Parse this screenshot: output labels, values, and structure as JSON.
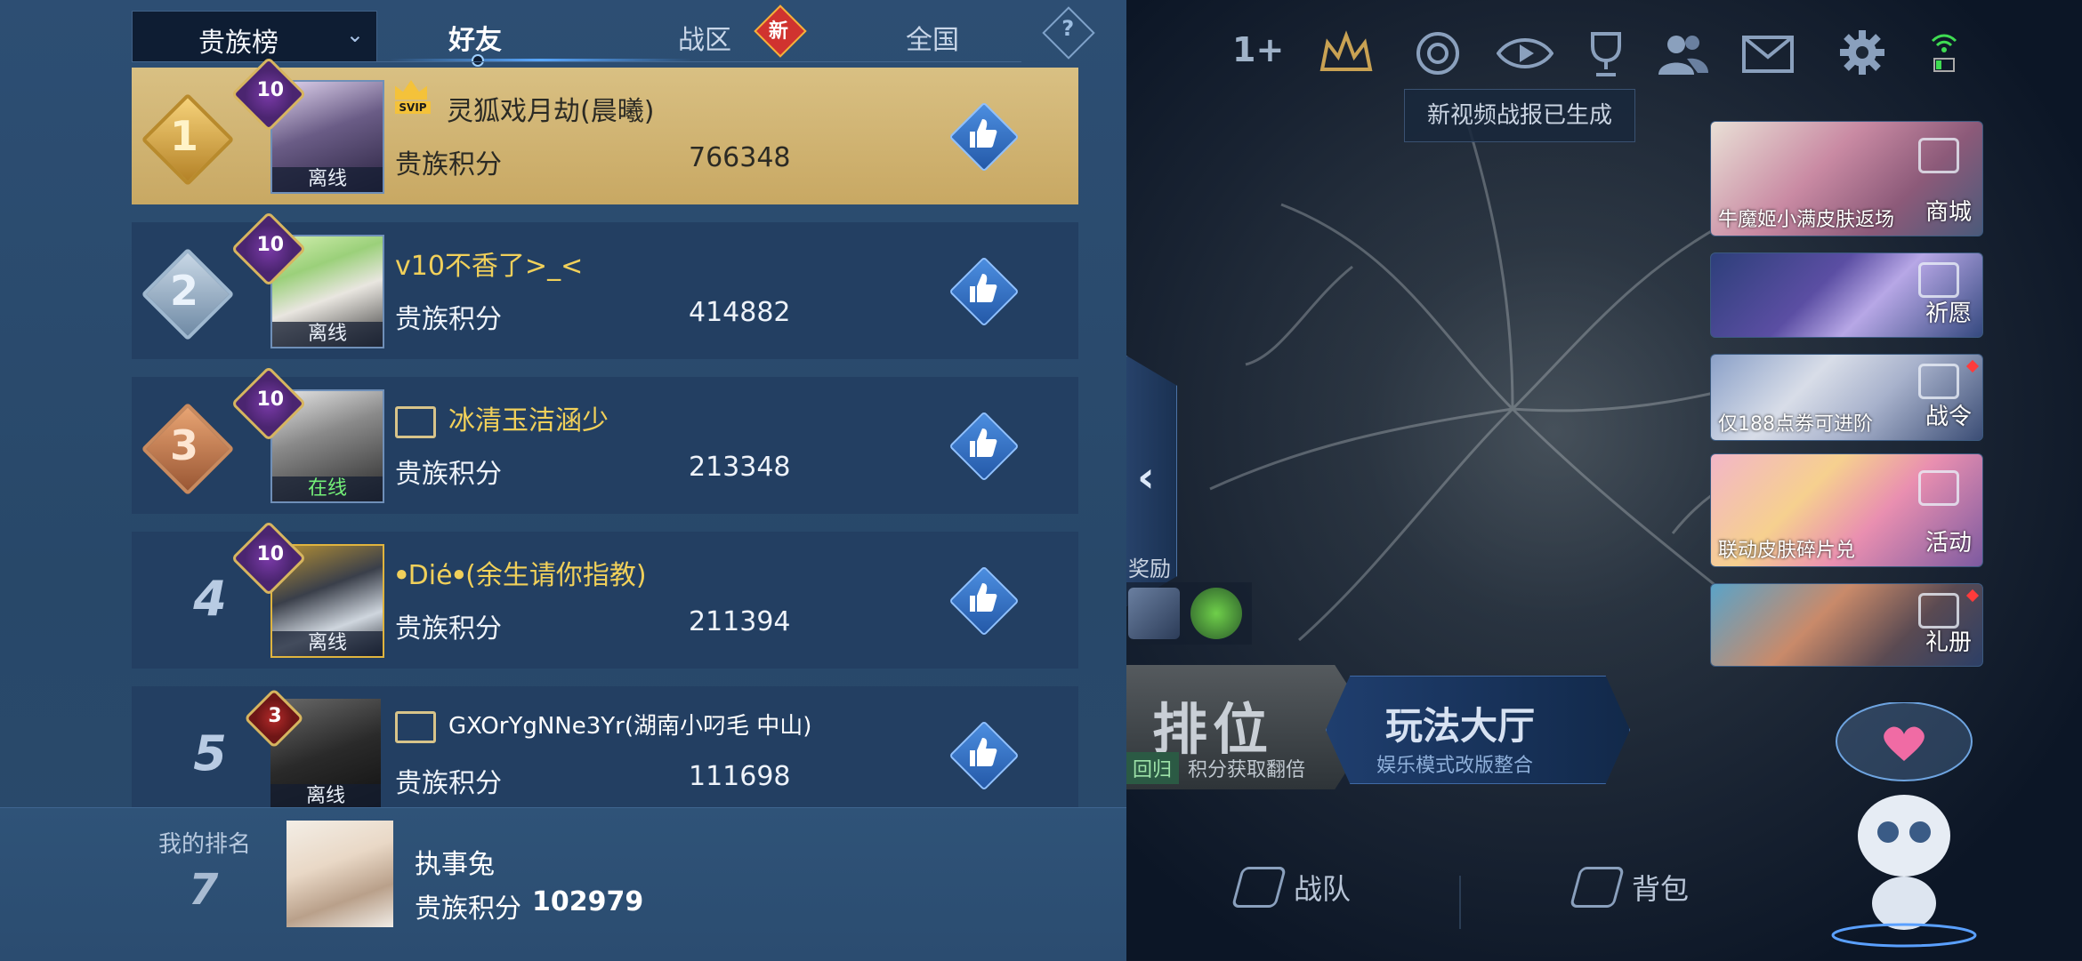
{
  "tabs": {
    "dropdown_label": "贵族榜",
    "items": [
      {
        "label": "好友",
        "active": true
      },
      {
        "label": "战区",
        "badge": "新"
      },
      {
        "label": "全国"
      }
    ],
    "help_label": "?"
  },
  "leaderboard": {
    "score_label": "贵族积分",
    "rows": [
      {
        "rank": "1",
        "name": "灵狐戏月劫(晨曦)",
        "score": "766348",
        "status": "离线",
        "vip": "10",
        "svip": "SVIP"
      },
      {
        "rank": "2",
        "name": "v10不香了>_<",
        "score": "414882",
        "status": "离线",
        "vip": "10"
      },
      {
        "rank": "3",
        "name": "冰清玉洁涵少",
        "score": "213348",
        "status": "在线",
        "vip": "10"
      },
      {
        "rank": "4",
        "name": "ꔷDie̒ꔷ(余生请你指教)",
        "score": "211394",
        "status": "离线",
        "vip": "10"
      },
      {
        "rank": "5",
        "name": "GXOrYgNNe3Yr(湖南小叼毛 中山)",
        "score": "111698",
        "status": "离线",
        "vip": "3"
      }
    ]
  },
  "my_rank": {
    "label": "我的排名",
    "rank": "7",
    "name": "执事兔",
    "score_label": "贵族积分",
    "score": "102979"
  },
  "lobby": {
    "top_counter": "1+",
    "tooltip": "新视频战报已生成",
    "side_cards": [
      {
        "caption": "牛魔姬小满皮肤返场",
        "label": "商城",
        "icon": "shop-icon"
      },
      {
        "caption": "",
        "label": "祈愿",
        "icon": "wish-icon"
      },
      {
        "caption": "仅188点券可进阶",
        "label": "战令",
        "icon": "battle-pass-icon"
      },
      {
        "caption": "联动皮肤碎片兑",
        "label": "活动",
        "icon": "event-icon"
      },
      {
        "caption": "",
        "label": "礼册",
        "icon": "gift-book-icon"
      }
    ],
    "reward_label": "奖励",
    "rank_button": {
      "title": "排位",
      "tag": "回归",
      "subtitle": "积分获取翻倍"
    },
    "mode_button": {
      "title": "玩法大厅",
      "subtitle": "娱乐模式改版整合"
    },
    "bottom_nav": [
      {
        "label": "战队",
        "icon": "team-icon"
      },
      {
        "label": "背包",
        "icon": "bag-icon"
      }
    ]
  },
  "colors": {
    "panel_bg": "#2a4a6c",
    "gold_row": "#d2b675",
    "accent_blue": "#58a7ff",
    "online_green": "#74f078",
    "vip_yellow_name": "#f1d05a"
  }
}
